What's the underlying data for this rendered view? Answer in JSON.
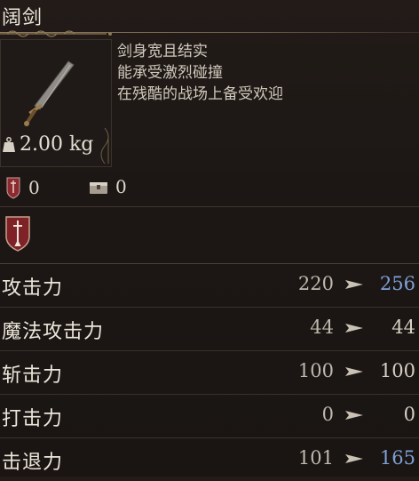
{
  "item": {
    "name": "阔剑",
    "weight": "2.00 kg",
    "description": [
      "剑身宽且结实",
      "能承受激烈碰撞",
      "在残酷的战场上备受欢迎"
    ]
  },
  "counts": {
    "first_value": "0",
    "second_value": "0"
  },
  "stats": [
    {
      "label": "攻击力",
      "from": "220",
      "to": "256",
      "change": "up"
    },
    {
      "label": "魔法攻击力",
      "from": "44",
      "to": "44",
      "change": "same"
    },
    {
      "label": "斩击力",
      "from": "100",
      "to": "100",
      "change": "same"
    },
    {
      "label": "打击力",
      "from": "0",
      "to": "0",
      "change": "same"
    },
    {
      "label": "击退力",
      "from": "101",
      "to": "165",
      "change": "up"
    }
  ],
  "colors": {
    "up": "#7fa0d6",
    "same": "#d6cfc3",
    "arrow": "#c9c2b4"
  },
  "icons": {
    "item": "sword-icon",
    "weight": "weight-icon",
    "badge_left": "red-crest-icon",
    "badge_right": "chest-icon",
    "category": "sword-emblem-icon"
  }
}
